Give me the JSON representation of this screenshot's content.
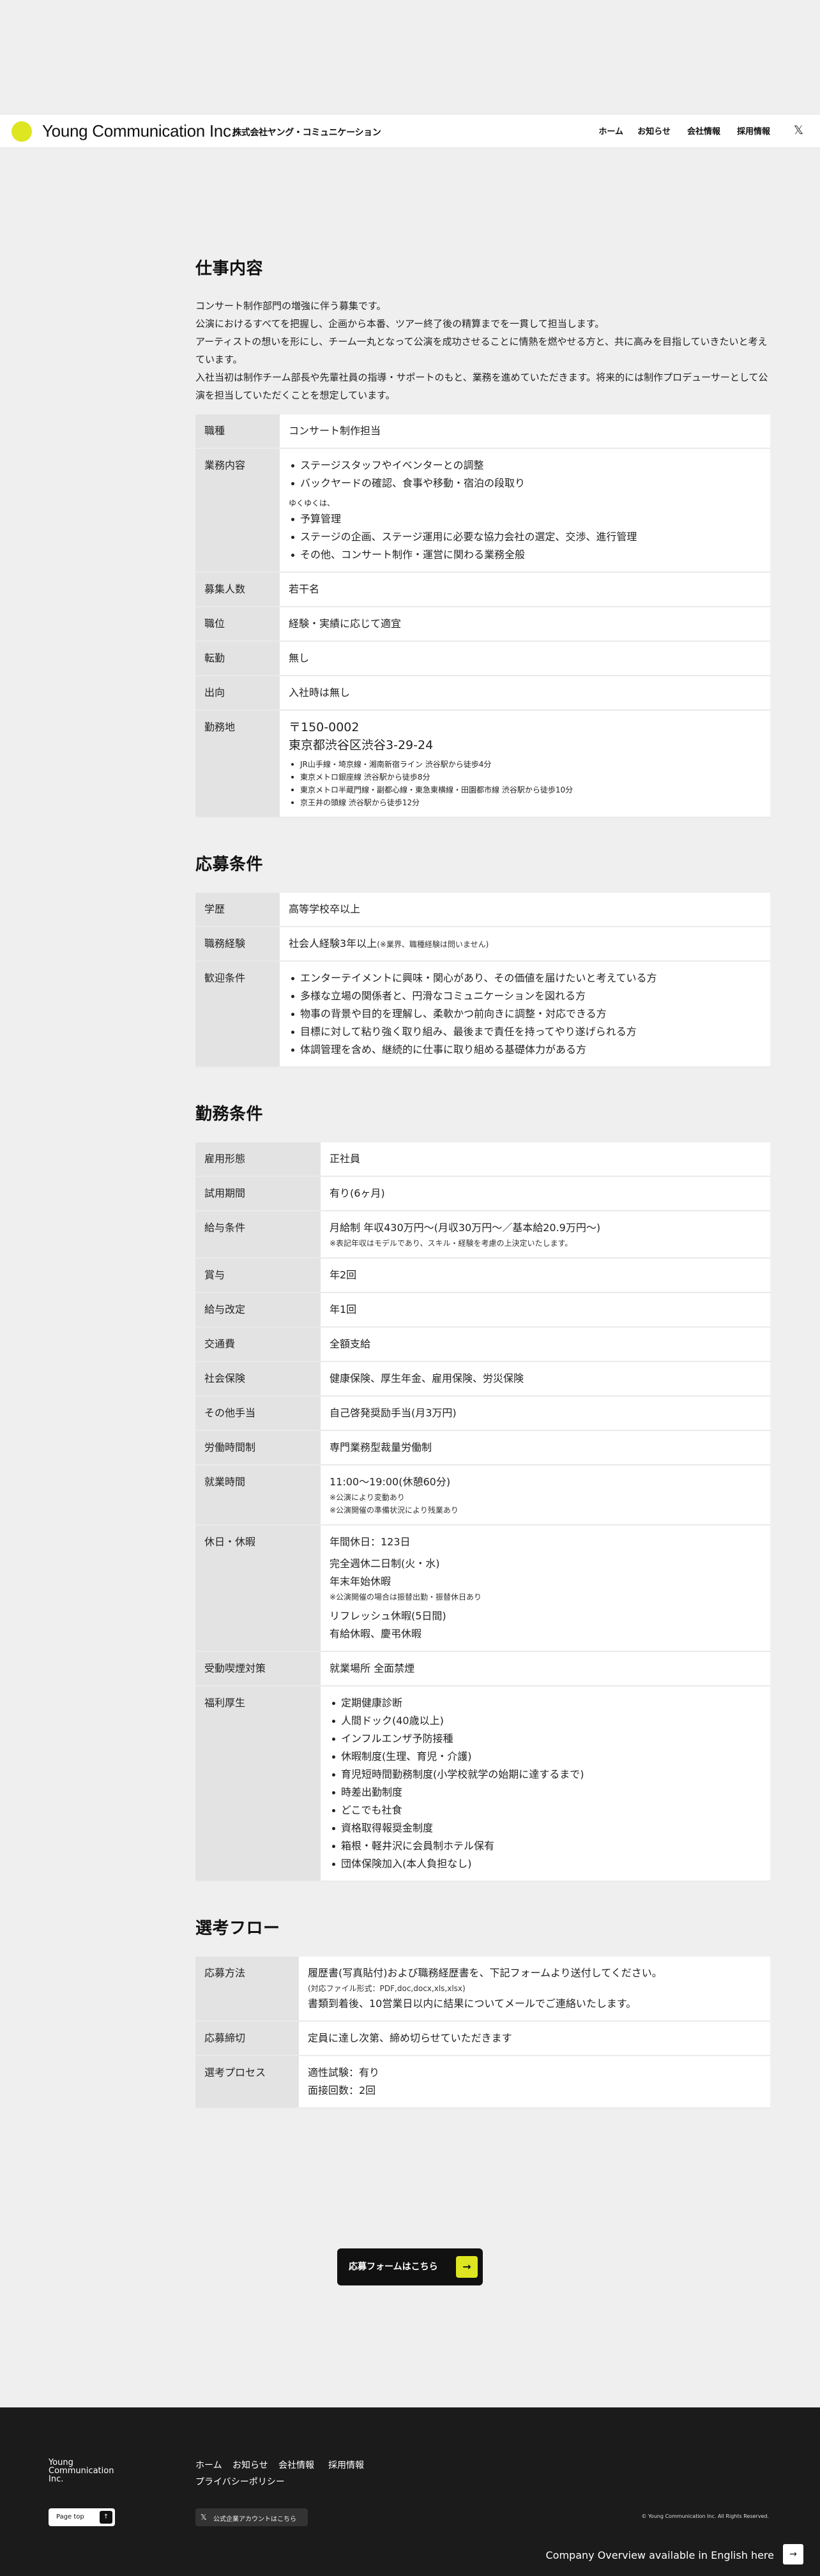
{
  "header": {
    "brand": "Young Communication Inc.",
    "brand_jp": "株式会社ヤング・コミュニケーション",
    "nav": [
      "ホーム",
      "お知らせ",
      "会社情報",
      "採用情報"
    ],
    "x_icon": "x-icon",
    "logo_icon": "logo-dot-icon"
  },
  "job": {
    "heading": "仕事内容",
    "intro": [
      "コンサート制作部門の増強に伴う募集です。",
      "公演におけるすべてを把握し、企画から本番、ツアー終了後の精算までを一貫して担当します。",
      "アーティストの想いを形にし、チーム一丸となって公演を成功させることに情熱を燃やせる方と、共に高みを目指していきたいと考えています。",
      "入社当初は制作チーム部長や先輩社員の指導・サポートのもと、業務を進めていただきます。将来的には制作プロデューサーとして公演を担当していただくことを想定しています。"
    ],
    "rows": {
      "r1": {
        "label": "職種",
        "value": "コンサート制作担当"
      },
      "r2": {
        "label": "業務内容",
        "items": [
          "ステージスタッフやイベンターとの調整",
          "バックヤードの確認、食事や移動・宿泊の段取り"
        ],
        "sub": "ゆくゆくは、",
        "items2": [
          "予算管理",
          "ステージの企画、ステージ運用に必要な協力会社の選定、交渉、進行管理",
          "その他、コンサート制作・運営に関わる業務全般"
        ]
      },
      "r3": {
        "label": "募集人数",
        "value": "若干名"
      },
      "r4": {
        "label": "職位",
        "value": "経験・実績に応じて適宜"
      },
      "r5": {
        "label": "転勤",
        "value": "無し"
      },
      "r6": {
        "label": "出向",
        "value": "入社時は無し"
      },
      "r7": {
        "label": "勤務地",
        "zip": "〒150-0002",
        "addr": "東京都渋谷区渋谷3-29-24",
        "access": [
          "JR山手線・埼京線・湘南新宿ライン 渋谷駅から徒歩4分",
          "東京メトロ銀座線 渋谷駅から徒歩8分",
          "東京メトロ半蔵門線・副都心線・東急東横線・田園都市線 渋谷駅から徒歩10分",
          "京王井の頭線 渋谷駅から徒歩12分"
        ]
      }
    }
  },
  "req": {
    "heading": "応募条件",
    "rows": {
      "r1": {
        "label": "学歴",
        "value": "高等学校卒以上"
      },
      "r2": {
        "label": "職務経験",
        "value": "社会人経験3年以上",
        "note": "(※業界、職種経験は問いません)"
      },
      "r3": {
        "label": "歓迎条件",
        "items": [
          "エンターテイメントに興味・関心があり、その価値を届けたいと考えている方",
          "多様な立場の関係者と、円滑なコミュニケーションを図れる方",
          "物事の背景や目的を理解し、柔軟かつ前向きに調整・対応できる方",
          "目標に対して粘り強く取り組み、最後まで責任を持ってやり遂げられる方",
          "体調管理を含め、継続的に仕事に取り組める基礎体力がある方"
        ]
      }
    }
  },
  "cond": {
    "heading": "勤務条件",
    "rows": {
      "r1": {
        "label": "雇用形態",
        "value": "正社員"
      },
      "r2": {
        "label": "試用期間",
        "value": "有り(6ヶ月)"
      },
      "r3": {
        "label": "給与条件",
        "value": "月給制 年収430万円〜(月収30万円〜／基本給20.9万円〜)",
        "note": "※表記年収はモデルであり、スキル・経験を考慮の上決定いたします。"
      },
      "r4": {
        "label": "賞与",
        "value": "年2回"
      },
      "r5": {
        "label": "給与改定",
        "value": "年1回"
      },
      "r6": {
        "label": "交通費",
        "value": "全額支給"
      },
      "r7": {
        "label": "社会保険",
        "value": "健康保険、厚生年金、雇用保険、労災保険"
      },
      "r8": {
        "label": "その他手当",
        "value": "自己啓発奨励手当(月3万円)"
      },
      "r9": {
        "label": "労働時間制",
        "value": "専門業務型裁量労働制"
      },
      "r10": {
        "label": "就業時間",
        "value": "11:00〜19:00(休憩60分)",
        "note1": "※公演により変動あり",
        "note2": "※公演開催の準備状況により残業あり"
      },
      "r11": {
        "label": "休日・休暇",
        "v1": "年間休日：123日",
        "v2": "完全週休二日制(火・水)",
        "v3": "年末年始休暇",
        "note": "※公演開催の場合は振替出勤・振替休日あり",
        "v4": "リフレッシュ休暇(5日間)",
        "v5": "有給休暇、慶弔休暇"
      },
      "r12": {
        "label": "受動喫煙対策",
        "value": "就業場所 全面禁煙"
      },
      "r13": {
        "label": "福利厚生",
        "items": [
          "定期健康診断",
          "人間ドック(40歳以上)",
          "インフルエンザ予防接種",
          "休暇制度(生理、育児・介護)",
          "育児短時間勤務制度(小学校就学の始期に達するまで)",
          "時差出勤制度",
          "どこでも社食",
          "資格取得報奨金制度",
          "箱根・軽井沢に会員制ホテル保有",
          "団体保険加入(本人負担なし)"
        ]
      }
    }
  },
  "flow": {
    "heading": "選考フロー",
    "rows": {
      "r1": {
        "label": "応募方法",
        "v1": "履歴書(写真貼付)および職務経歴書を、下記フォームより送付してください。",
        "note": "(対応ファイル形式：PDF,doc,docx,xls,xlsx)",
        "v2": "書類到着後、10営業日以内に結果についてメールでご連絡いたします。"
      },
      "r2": {
        "label": "応募締切",
        "value": "定員に達し次第、締め切らせていただきます"
      },
      "r3": {
        "label": "選考プロセス",
        "v1": "適性試験：有り",
        "v2": "面接回数：2回"
      }
    }
  },
  "cta": {
    "label": "応募フォームはこちら",
    "icon": "arrow-right-icon"
  },
  "footer": {
    "brand_l1": "Young",
    "brand_l2": "Communication",
    "brand_l3": "Inc.",
    "nav": [
      "ホーム",
      "お知らせ",
      "会社情報",
      "採用情報"
    ],
    "privacy": "プライバシーポリシー",
    "page_top": "Page top",
    "x_link": "公式企業アカウントはこちら",
    "copyright": "© Young Communication Inc. All Rights Reserved.",
    "english": "Company Overview available in English here"
  }
}
